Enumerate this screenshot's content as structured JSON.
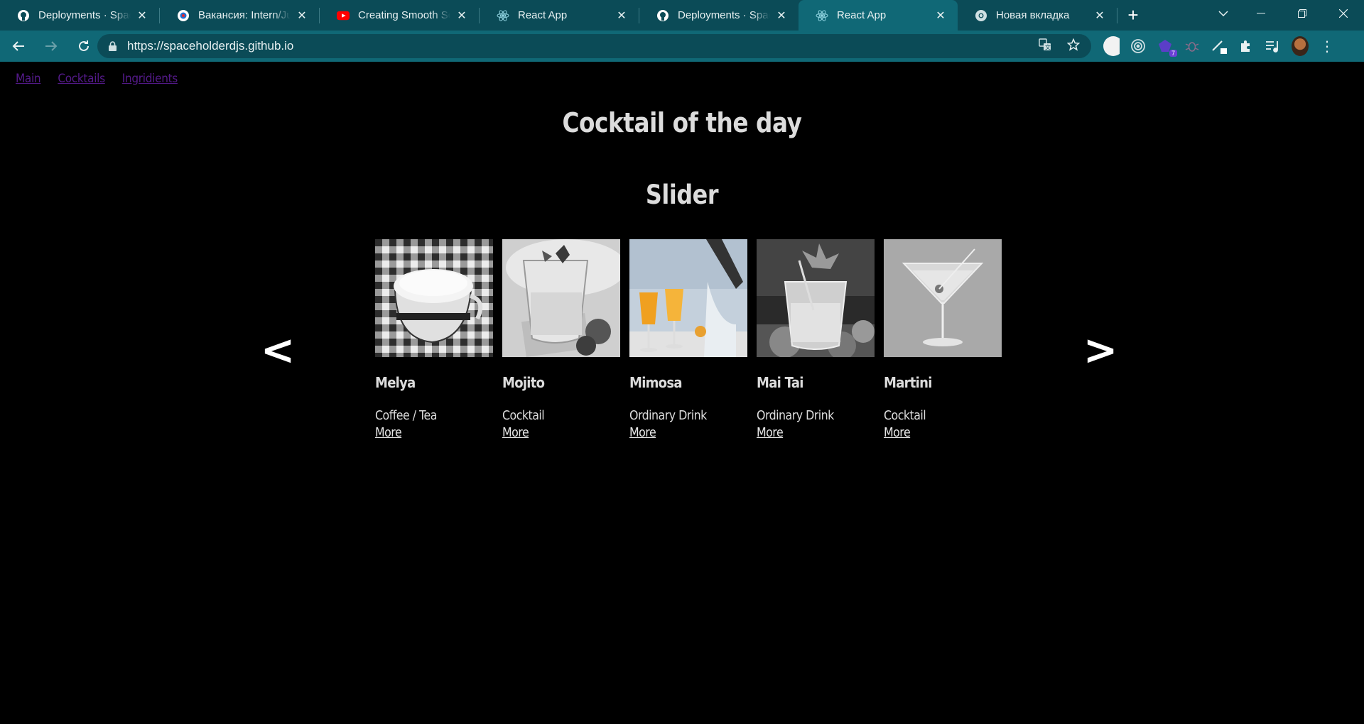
{
  "browser": {
    "tabs": [
      {
        "title": "Deployments · Spaceh",
        "icon": "github-icon"
      },
      {
        "title": "Вакансия: Intern/Junio",
        "icon": "hh-icon"
      },
      {
        "title": "Creating Smooth Scro",
        "icon": "youtube-icon"
      },
      {
        "title": "React App",
        "icon": "react-icon"
      },
      {
        "title": "Deployments · Spaceh",
        "icon": "github-icon"
      },
      {
        "title": "React App",
        "icon": "react-icon",
        "active": true
      },
      {
        "title": "Новая вкладка",
        "icon": "chrome-icon"
      }
    ],
    "url": "https://spaceholderdjs.github.io",
    "extension_badge": "7"
  },
  "nav": {
    "main": "Main",
    "cocktails": "Cocktails",
    "ingredients": "Ingridients"
  },
  "page": {
    "title": "Cocktail of the day",
    "slider_title": "Slider",
    "prev_arrow": "<",
    "next_arrow": ">"
  },
  "cards": [
    {
      "name": "Melya",
      "category": "Coffee / Tea",
      "more": "More"
    },
    {
      "name": "Mojito",
      "category": "Cocktail",
      "more": "More"
    },
    {
      "name": "Mimosa",
      "category": "Ordinary Drink",
      "more": "More"
    },
    {
      "name": "Mai Tai",
      "category": "Ordinary Drink",
      "more": "More"
    },
    {
      "name": "Martini",
      "category": "Cocktail",
      "more": "More"
    }
  ],
  "colors": {
    "tabbar": "#0b4b57",
    "toolbar": "#106876",
    "link_visited": "#551a8b",
    "page_bg": "#000000",
    "heading": "#dcdcdc"
  }
}
